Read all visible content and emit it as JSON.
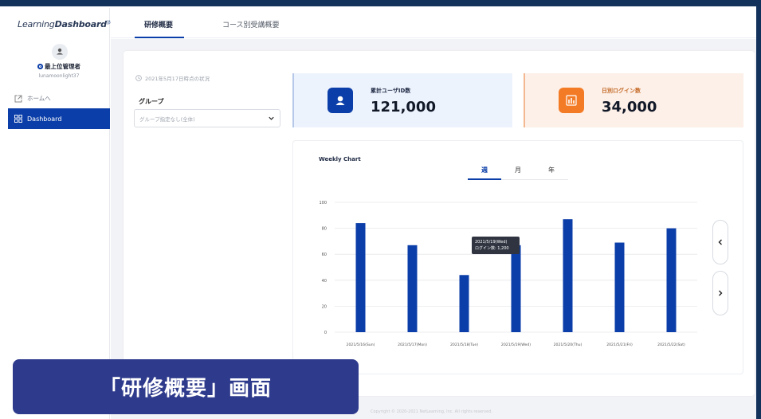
{
  "app": {
    "brand_prefix": "L",
    "brand_plain": "earning",
    "brand_bold": "Dashboard",
    "brand_sup": "[β]"
  },
  "user": {
    "role": "最上位管理者",
    "username": "lunamoonlight37"
  },
  "sidebar": {
    "items": [
      {
        "label": "ホームへ"
      },
      {
        "label": "Dashboard"
      }
    ]
  },
  "tabs": [
    {
      "label": "研修概要"
    },
    {
      "label": "コース別受講概要"
    }
  ],
  "filter": {
    "as_of": "2021年5月17日時点の状況",
    "group_label": "グループ",
    "group_value": "グループ指定なし(全体)"
  },
  "stats": [
    {
      "label": "累計ユーザID数",
      "value": "121,000",
      "icon": "user-icon"
    },
    {
      "label": "日別ログイン数",
      "value": "34,000",
      "icon": "bar-chart-icon"
    }
  ],
  "period_tabs": [
    "週",
    "月",
    "年"
  ],
  "tooltip": {
    "line1": "2021/5/19(Wed)",
    "line2": "ログイン数: 1,200"
  },
  "copyright": "Copyright © 2020-2021 NetLearning, Inc. All rights reserved.",
  "banner": "「研修概要」画面",
  "colors": {
    "accent": "#0b3ea8",
    "orange": "#f47b25",
    "banner": "#2e3a8c"
  },
  "chart_data": {
    "type": "bar",
    "title": "Weekly Chart",
    "categories": [
      "2021/5/16(Sun)",
      "2021/5/17(Mon)",
      "2021/5/18(Tue)",
      "2021/5/19(Wed)",
      "2021/5/20(Thu)",
      "2021/5/21(Fri)",
      "2021/5/22(Sat)"
    ],
    "values": [
      84,
      67,
      44,
      67,
      87,
      69,
      80
    ],
    "ylim": [
      0,
      100
    ],
    "yticks": [
      0,
      20,
      40,
      60,
      80,
      100
    ],
    "grid": true,
    "color": "#0b3ea8"
  }
}
